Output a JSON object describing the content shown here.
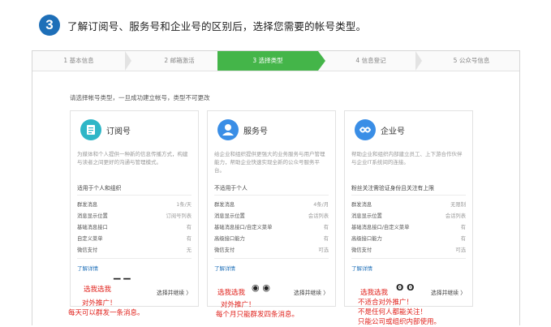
{
  "header": {
    "step_number": "3",
    "text": "了解订阅号、服务号和企业号的区别后，选择您需要的帐号类型。"
  },
  "wizard": {
    "steps": [
      "1 基本信息",
      "2 邮箱激活",
      "3 选择类型",
      "4 信息登记",
      "5 公众号信息"
    ],
    "active_step": 3
  },
  "intro": "请选择帐号类型，一旦成功建立帐号，类型不可更改",
  "cards": [
    {
      "title": "订阅号",
      "icon": "subscription-icon",
      "desc": "为媒体和个人提供一种新的信息传播方式，构建与读者之间更好的沟通与管理模式。",
      "suit": "适用于个人和组织",
      "features": [
        {
          "k": "群发消息",
          "v": "1条/天"
        },
        {
          "k": "消息显示位置",
          "v": "订阅号列表"
        },
        {
          "k": "基础消息接口",
          "v": "有"
        },
        {
          "k": "自定义菜单",
          "v": "有"
        },
        {
          "k": "微信支付",
          "v": "无"
        }
      ],
      "more": "了解详情",
      "select": "选择并继续 〉"
    },
    {
      "title": "服务号",
      "icon": "service-icon",
      "desc": "给企业和组织提供更强大的业务服务与用户管理能力，帮助企业快速实现全新的公众号服务平台。",
      "suit": "不适用于个人",
      "features": [
        {
          "k": "群发消息",
          "v": "4条/月"
        },
        {
          "k": "消息显示位置",
          "v": "会话列表"
        },
        {
          "k": "基础消息接口/自定义菜单",
          "v": "有"
        },
        {
          "k": "高级接口能力",
          "v": "有"
        },
        {
          "k": "微信支付",
          "v": "可选"
        }
      ],
      "more": "了解详情",
      "select": "选择并继续 〉"
    },
    {
      "title": "企业号",
      "icon": "enterprise-icon",
      "desc": "帮助企业和组织内部建立员工、上下游合作伙伴与企业IT系统间的连接。",
      "suit": "粉丝关注需验证身份且关注有上限",
      "features": [
        {
          "k": "群发消息",
          "v": "无限制"
        },
        {
          "k": "消息显示位置",
          "v": "会话列表"
        },
        {
          "k": "基础消息接口/自定义菜单",
          "v": "有"
        },
        {
          "k": "高级接口能力",
          "v": "有"
        },
        {
          "k": "微信支付",
          "v": "可选"
        }
      ],
      "more": "了解详情",
      "select": "选择并继续 〉"
    }
  ],
  "annotations": [
    {
      "pick": "选我选我",
      "lines": [
        "对外推广！",
        "每天可以群发一条消息。"
      ]
    },
    {
      "pick": "选我选我",
      "lines": [
        "对外推广！",
        "每个月只能群发四条消息。"
      ]
    },
    {
      "pick": "选我选我",
      "lines": [
        "不适合对外推广！",
        "不是任何人都能关注！",
        "只能公司或组织内部使用。"
      ]
    }
  ],
  "colors": {
    "accent": "#44b549",
    "brand_blue": "#1e6fb8",
    "note_red": "#e0211b",
    "icon_blue": "#3a8ee6",
    "icon_teal": "#2eb6c7"
  }
}
